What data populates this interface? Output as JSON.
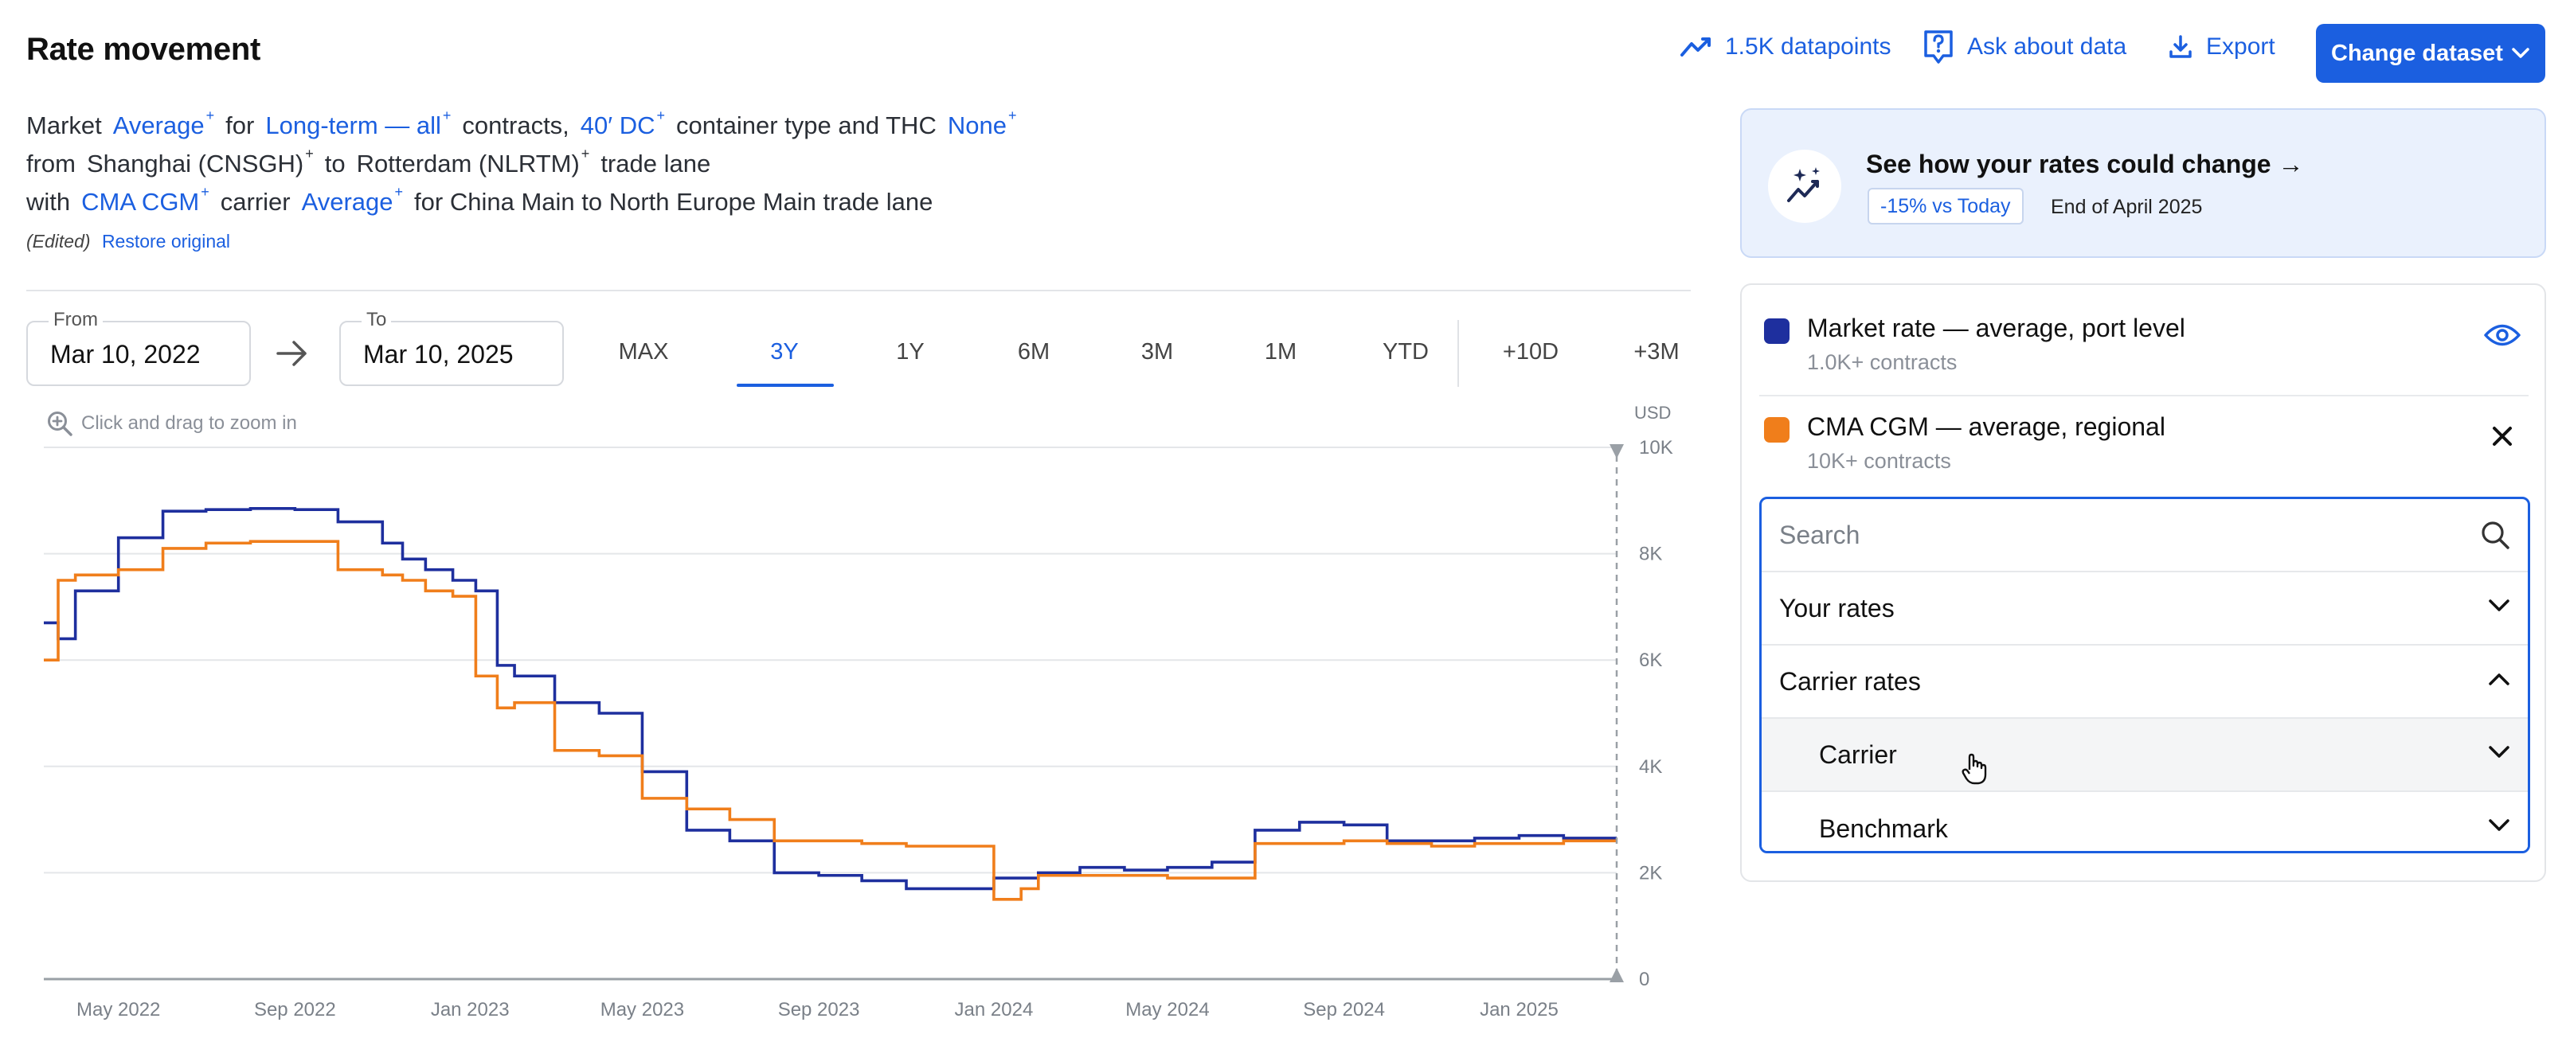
{
  "header": {
    "title": "Rate movement",
    "datapoints_label": "1.5K datapoints",
    "ask_label": "Ask about data",
    "export_label": "Export",
    "change_dataset_label": "Change dataset"
  },
  "description": {
    "line1": [
      {
        "text": "Market",
        "link": false
      },
      {
        "text": "Average",
        "link": true,
        "plus": true
      },
      {
        "text": "for",
        "link": false
      },
      {
        "text": "Long-term — all",
        "link": true,
        "plus": true
      },
      {
        "text": "contracts,",
        "link": false
      },
      {
        "text": "40′ DC",
        "link": true,
        "plus": true
      },
      {
        "text": "container type and THC",
        "link": false
      },
      {
        "text": "None",
        "link": true,
        "plus": true
      }
    ],
    "line2": [
      {
        "text": "from",
        "link": false
      },
      {
        "text": "Shanghai (CNSGH)",
        "link": false,
        "plus": true
      },
      {
        "text": "to",
        "link": false
      },
      {
        "text": "Rotterdam (NLRTM)",
        "link": false,
        "plus": true
      },
      {
        "text": "trade lane",
        "link": false
      }
    ],
    "line3": [
      {
        "text": "with",
        "link": false
      },
      {
        "text": "CMA CGM",
        "link": true,
        "plus": true
      },
      {
        "text": "carrier",
        "link": false
      },
      {
        "text": "Average",
        "link": true,
        "plus": true
      },
      {
        "text": "for China Main to North Europe Main trade lane",
        "link": false
      }
    ],
    "edited_label": "(Edited)",
    "restore_label": "Restore original"
  },
  "date_range": {
    "from_label": "From",
    "from_value": "Mar 10, 2022",
    "to_label": "To",
    "to_value": "Mar 10, 2025",
    "ranges": [
      "MAX",
      "3Y",
      "1Y",
      "6M",
      "3M",
      "1M",
      "YTD",
      "+10D",
      "+3M"
    ],
    "active_range": "3Y"
  },
  "chart": {
    "zoom_hint": "Click and drag to zoom in",
    "unit": "USD"
  },
  "chart_data": {
    "type": "line",
    "x_tick_labels": [
      "May 2022",
      "Sep 2022",
      "Jan 2023",
      "May 2023",
      "Sep 2023",
      "Jan 2024",
      "May 2024",
      "Sep 2024",
      "Jan 2025"
    ],
    "y_tick_labels": [
      "10K",
      "8K",
      "6K",
      "4K",
      "2K",
      "0"
    ],
    "ylim": [
      0,
      10000
    ],
    "xlim": [
      "2022-03-10",
      "2025-03-10"
    ],
    "grid": true,
    "series": [
      {
        "name": "Market rate — average, port level",
        "color": "#1e2f9e",
        "points": [
          [
            "2022-03-10",
            6700
          ],
          [
            "2022-03-20",
            6400
          ],
          [
            "2022-04-01",
            7300
          ],
          [
            "2022-05-01",
            8300
          ],
          [
            "2022-06-01",
            8800
          ],
          [
            "2022-07-01",
            8830
          ],
          [
            "2022-08-01",
            8850
          ],
          [
            "2022-09-01",
            8830
          ],
          [
            "2022-10-01",
            8600
          ],
          [
            "2022-11-01",
            8200
          ],
          [
            "2022-11-15",
            7900
          ],
          [
            "2022-12-01",
            7700
          ],
          [
            "2022-12-20",
            7500
          ],
          [
            "2023-01-05",
            7300
          ],
          [
            "2023-01-20",
            5900
          ],
          [
            "2023-02-01",
            5700
          ],
          [
            "2023-03-01",
            5200
          ],
          [
            "2023-04-01",
            5000
          ],
          [
            "2023-05-01",
            3900
          ],
          [
            "2023-06-01",
            2800
          ],
          [
            "2023-07-01",
            2600
          ],
          [
            "2023-08-01",
            2000
          ],
          [
            "2023-09-01",
            1950
          ],
          [
            "2023-10-01",
            1850
          ],
          [
            "2023-11-01",
            1700
          ],
          [
            "2023-12-01",
            1700
          ],
          [
            "2024-01-01",
            1900
          ],
          [
            "2024-02-01",
            2000
          ],
          [
            "2024-03-01",
            2100
          ],
          [
            "2024-04-01",
            2050
          ],
          [
            "2024-05-01",
            2100
          ],
          [
            "2024-06-01",
            2200
          ],
          [
            "2024-07-01",
            2800
          ],
          [
            "2024-08-01",
            2950
          ],
          [
            "2024-09-01",
            2900
          ],
          [
            "2024-10-01",
            2600
          ],
          [
            "2024-11-01",
            2600
          ],
          [
            "2024-12-01",
            2650
          ],
          [
            "2025-01-01",
            2700
          ],
          [
            "2025-02-01",
            2650
          ],
          [
            "2025-03-10",
            2650
          ]
        ]
      },
      {
        "name": "CMA CGM — average, regional",
        "color": "#f07e1b",
        "points": [
          [
            "2022-03-10",
            6000
          ],
          [
            "2022-03-20",
            7500
          ],
          [
            "2022-04-01",
            7600
          ],
          [
            "2022-05-01",
            7700
          ],
          [
            "2022-06-01",
            8100
          ],
          [
            "2022-07-01",
            8200
          ],
          [
            "2022-08-01",
            8230
          ],
          [
            "2022-09-01",
            8230
          ],
          [
            "2022-10-01",
            7700
          ],
          [
            "2022-11-01",
            7600
          ],
          [
            "2022-11-15",
            7500
          ],
          [
            "2022-12-01",
            7300
          ],
          [
            "2022-12-20",
            7200
          ],
          [
            "2023-01-05",
            5700
          ],
          [
            "2023-01-20",
            5100
          ],
          [
            "2023-02-01",
            5200
          ],
          [
            "2023-03-01",
            4300
          ],
          [
            "2023-04-01",
            4200
          ],
          [
            "2023-05-01",
            3400
          ],
          [
            "2023-06-01",
            3200
          ],
          [
            "2023-07-01",
            3000
          ],
          [
            "2023-08-01",
            2600
          ],
          [
            "2023-09-01",
            2600
          ],
          [
            "2023-10-01",
            2550
          ],
          [
            "2023-11-01",
            2500
          ],
          [
            "2023-12-01",
            2500
          ],
          [
            "2024-01-01",
            1500
          ],
          [
            "2024-01-20",
            1700
          ],
          [
            "2024-02-01",
            1950
          ],
          [
            "2024-04-01",
            1950
          ],
          [
            "2024-05-01",
            1900
          ],
          [
            "2024-06-01",
            1900
          ],
          [
            "2024-07-01",
            2550
          ],
          [
            "2024-08-01",
            2550
          ],
          [
            "2024-09-01",
            2600
          ],
          [
            "2024-10-01",
            2550
          ],
          [
            "2024-11-01",
            2500
          ],
          [
            "2024-12-01",
            2550
          ],
          [
            "2025-01-01",
            2550
          ],
          [
            "2025-02-01",
            2600
          ],
          [
            "2025-03-10",
            2600
          ]
        ]
      }
    ]
  },
  "promo": {
    "title": "See how your rates could change →",
    "badge": "-15% vs Today",
    "date": "End of April 2025"
  },
  "series_panel": {
    "series": [
      {
        "name": "Market rate — average, port level",
        "sub": "1.0K+ contracts",
        "color": "#1e2f9e",
        "action_icon": "eye-icon"
      },
      {
        "name": "CMA CGM — average, regional",
        "sub": "10K+ contracts",
        "color": "#f07e1b",
        "action_icon": "close-icon"
      }
    ],
    "dropdown": {
      "search_placeholder": "Search",
      "items": [
        {
          "label": "Your rates",
          "expanded": false,
          "level": 0
        },
        {
          "label": "Carrier rates",
          "expanded": true,
          "level": 0
        },
        {
          "label": "Carrier",
          "expanded": false,
          "level": 1
        },
        {
          "label": "Benchmark",
          "expanded": false,
          "level": 1
        }
      ]
    }
  }
}
